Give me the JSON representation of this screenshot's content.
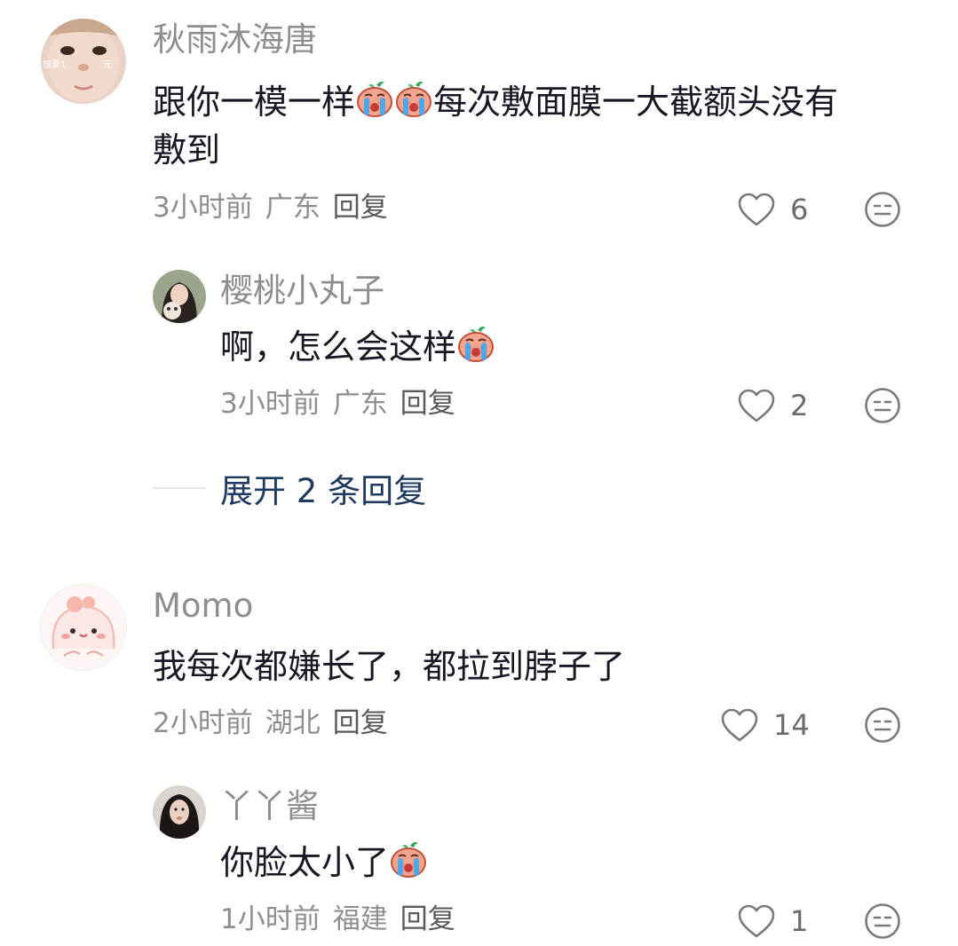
{
  "colors": {
    "username": "#8e8e8e",
    "text": "#161823",
    "meta": "#8e8e8e",
    "expand": "#1f3a5f"
  },
  "comments": [
    {
      "avatar_text_left": "想要1",
      "avatar_text_right": "元",
      "username": "秋雨沐海唐",
      "text_line1_a": "跟你一模一样",
      "text_line1_b": "每次敷面膜一大截额头没有",
      "text_line2": "敷到",
      "time": "3小时前",
      "location": "广东",
      "reply": "回复",
      "likes": "6",
      "emoji": "crying-peach-emoji"
    },
    {
      "username": "樱桃小丸子",
      "text": "啊，怎么会这样",
      "time": "3小时前",
      "location": "广东",
      "reply": "回复",
      "likes": "2",
      "emoji": "crying-peach-emoji"
    },
    {
      "username": "Momo",
      "text": "我每次都嫌长了，都拉到脖子了",
      "time": "2小时前",
      "location": "湖北",
      "reply": "回复",
      "likes": "14"
    },
    {
      "username": "丫丫酱",
      "text": "你脸太小了",
      "time": "1小时前",
      "location": "福建",
      "reply": "回复",
      "likes": "1",
      "emoji": "crying-peach-emoji"
    }
  ],
  "expand_replies": "展开 2 条回复"
}
